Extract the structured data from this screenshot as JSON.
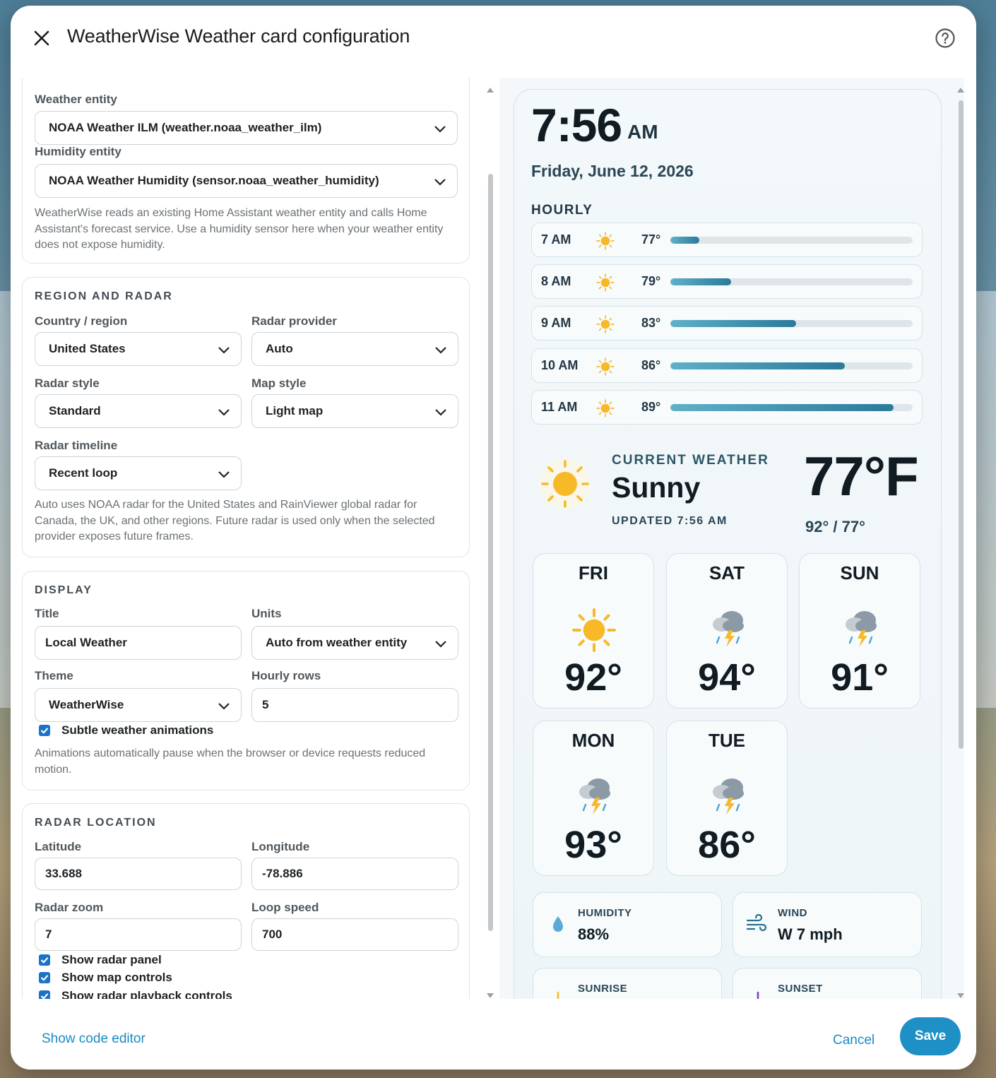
{
  "dialog": {
    "title": "WeatherWise Weather card configuration"
  },
  "entities": {
    "weather_label": "Weather entity",
    "weather_value": "NOAA Weather ILM (weather.noaa_weather_ilm)",
    "humidity_label": "Humidity entity",
    "humidity_value": "NOAA Weather Humidity (sensor.noaa_weather_humidity)",
    "help": "WeatherWise reads an existing Home Assistant weather entity and calls Home Assistant's forecast service. Use a humidity sensor here when your weather entity does not expose humidity."
  },
  "region": {
    "heading": "REGION AND RADAR",
    "country_label": "Country / region",
    "country_value": "United States",
    "provider_label": "Radar provider",
    "provider_value": "Auto",
    "style_label": "Radar style",
    "style_value": "Standard",
    "map_label": "Map style",
    "map_value": "Light map",
    "timeline_label": "Radar timeline",
    "timeline_value": "Recent loop",
    "help": "Auto uses NOAA radar for the United States and RainViewer global radar for Canada, the UK, and other regions. Future radar is used only when the selected provider exposes future frames."
  },
  "display": {
    "heading": "DISPLAY",
    "title_label": "Title",
    "title_value": "Local Weather",
    "units_label": "Units",
    "units_value": "Auto from weather entity",
    "theme_label": "Theme",
    "theme_value": "WeatherWise",
    "rows_label": "Hourly rows",
    "rows_value": "5",
    "anim_label": "Subtle weather animations",
    "help": "Animations automatically pause when the browser or device requests reduced motion."
  },
  "radar_location": {
    "heading": "RADAR LOCATION",
    "lat_label": "Latitude",
    "lat_value": "33.688",
    "lon_label": "Longitude",
    "lon_value": "-78.886",
    "zoom_label": "Radar zoom",
    "zoom_value": "7",
    "speed_label": "Loop speed",
    "speed_value": "700",
    "chk_panel": "Show radar panel",
    "chk_controls": "Show map controls",
    "chk_playback": "Show radar playback controls"
  },
  "preview": {
    "time": "7:56",
    "ampm": "AM",
    "date": "Friday, June 12, 2026",
    "hourly_heading": "HOURLY",
    "hourly": [
      {
        "time": "7 AM",
        "temp": "77°",
        "fill": 0.12
      },
      {
        "time": "8 AM",
        "temp": "79°",
        "fill": 0.25
      },
      {
        "time": "9 AM",
        "temp": "83°",
        "fill": 0.52
      },
      {
        "time": "10 AM",
        "temp": "86°",
        "fill": 0.72
      },
      {
        "time": "11 AM",
        "temp": "89°",
        "fill": 0.92
      }
    ],
    "current_label": "CURRENT WEATHER",
    "condition": "Sunny",
    "updated": "UPDATED 7:56 AM",
    "temp": "77°F",
    "hilo": "92° / 77°",
    "days": [
      {
        "name": "FRI",
        "temp": "92°",
        "icon": "sun-icon"
      },
      {
        "name": "SAT",
        "temp": "94°",
        "icon": "thunderstorm-icon"
      },
      {
        "name": "SUN",
        "temp": "91°",
        "icon": "thunderstorm-icon"
      },
      {
        "name": "MON",
        "temp": "93°",
        "icon": "thunderstorm-icon"
      },
      {
        "name": "TUE",
        "temp": "86°",
        "icon": "thunderstorm-icon"
      }
    ],
    "humidity_label": "HUMIDITY",
    "humidity_value": "88%",
    "wind_label": "WIND",
    "wind_value": "W 7 mph",
    "sunrise_label": "SUNRISE",
    "sunset_label": "SUNSET"
  },
  "footer": {
    "code_editor": "Show code editor",
    "cancel": "Cancel",
    "save": "Save"
  },
  "colors": {
    "accent": "#1f90c6",
    "checkbox": "#1a73c9",
    "sun": "#f7b928"
  }
}
